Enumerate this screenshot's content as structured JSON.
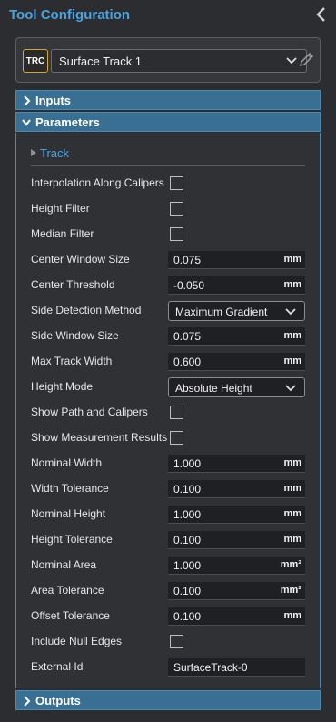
{
  "header": {
    "title": "Tool Configuration"
  },
  "tool": {
    "badge": "TRC",
    "name": "Surface Track 1"
  },
  "sections": {
    "inputs": "Inputs",
    "parameters": "Parameters",
    "outputs": "Outputs"
  },
  "track": {
    "label": "Track"
  },
  "params": [
    {
      "label": "Interpolation Along Calipers",
      "type": "checkbox",
      "checked": false
    },
    {
      "label": "Height Filter",
      "type": "checkbox",
      "checked": false
    },
    {
      "label": "Median Filter",
      "type": "checkbox",
      "checked": false
    },
    {
      "label": "Center Window Size",
      "type": "number",
      "value": "0.075",
      "unit": "mm"
    },
    {
      "label": "Center Threshold",
      "type": "number",
      "value": "-0.050",
      "unit": "mm"
    },
    {
      "label": "Side Detection Method",
      "type": "select",
      "value": "Maximum Gradient"
    },
    {
      "label": "Side Window Size",
      "type": "number",
      "value": "0.075",
      "unit": "mm"
    },
    {
      "label": "Max Track Width",
      "type": "number",
      "value": "0.600",
      "unit": "mm"
    },
    {
      "label": "Height Mode",
      "type": "select",
      "value": "Absolute Height"
    },
    {
      "label": "Show Path and Calipers",
      "type": "checkbox",
      "checked": false
    },
    {
      "label": "Show Measurement Results",
      "type": "checkbox",
      "checked": false
    },
    {
      "label": "Nominal Width",
      "type": "number",
      "value": "1.000",
      "unit": "mm"
    },
    {
      "label": "Width Tolerance",
      "type": "number",
      "value": "0.100",
      "unit": "mm"
    },
    {
      "label": "Nominal Height",
      "type": "number",
      "value": "1.000",
      "unit": "mm"
    },
    {
      "label": "Height Tolerance",
      "type": "number",
      "value": "0.100",
      "unit": "mm"
    },
    {
      "label": "Nominal Area",
      "type": "number",
      "value": "1.000",
      "unit": "mm²"
    },
    {
      "label": "Area Tolerance",
      "type": "number",
      "value": "0.100",
      "unit": "mm²"
    },
    {
      "label": "Offset Tolerance",
      "type": "number",
      "value": "0.100",
      "unit": "mm"
    },
    {
      "label": "Include Null Edges",
      "type": "checkbox",
      "checked": false
    },
    {
      "label": "External Id",
      "type": "text",
      "value": "SurfaceTrack-0"
    }
  ],
  "colors": {
    "accent": "#4aa3df",
    "section_bar": "#3a6f94",
    "badge_border": "#d4a838"
  }
}
